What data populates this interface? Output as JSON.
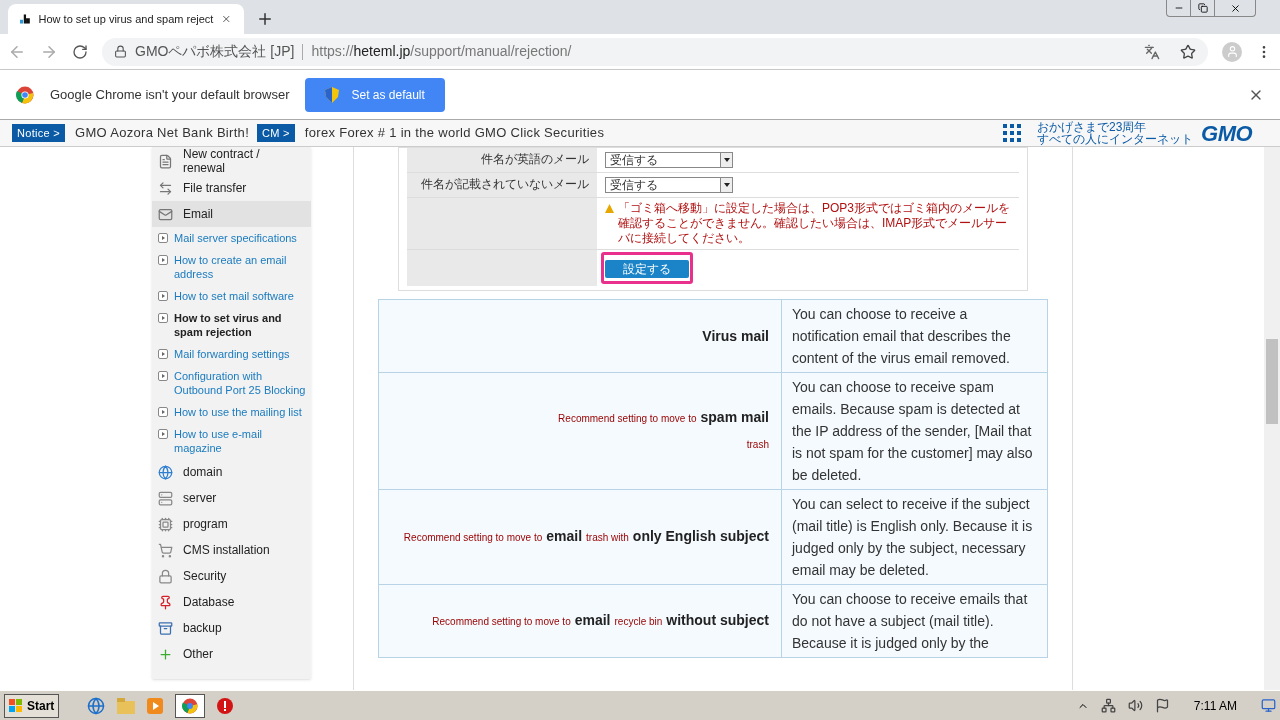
{
  "browser": {
    "tab": {
      "title": "How to set up virus and spam reject"
    },
    "address": {
      "org": "GMOペパボ株式会社 [JP]",
      "scheme": "https://",
      "host": "heteml.jp",
      "path": "/support/manual/rejection/"
    }
  },
  "infobar": {
    "message": "Google Chrome isn't your default browser",
    "button": "Set as default"
  },
  "ticker": {
    "items": [
      {
        "badge": "Notice >",
        "text": "GMO Aozora Net Bank Birth!"
      },
      {
        "badge": "CM >",
        "text": "forex Forex # 1 in the world GMO Click Securities"
      }
    ],
    "logo": {
      "tagline_1": "おかげさまで23周年",
      "tagline_2": "すべての人にインターネット",
      "mark": "GMO"
    }
  },
  "sidebar": {
    "items": [
      {
        "kind": "category",
        "label": "New contract / renewal",
        "selected": false
      },
      {
        "kind": "category",
        "label": "File transfer",
        "selected": false
      },
      {
        "kind": "category",
        "label": "Email",
        "selected": true
      },
      {
        "kind": "link",
        "label": "Mail server specifications",
        "selected": false
      },
      {
        "kind": "link",
        "label": "How to create an email address",
        "selected": false
      },
      {
        "kind": "link",
        "label": "How to set mail software",
        "selected": false
      },
      {
        "kind": "link",
        "label": "How to set virus and spam rejection",
        "selected": true
      },
      {
        "kind": "link",
        "label": "Mail forwarding settings",
        "selected": false
      },
      {
        "kind": "link",
        "label": "Configuration with Outbound Port 25 Blocking",
        "selected": false
      },
      {
        "kind": "link",
        "label": "How to use the mailing list",
        "selected": false
      },
      {
        "kind": "link",
        "label": "How to use e-mail magazine",
        "selected": false
      },
      {
        "kind": "category",
        "label": "domain",
        "selected": false
      },
      {
        "kind": "category",
        "label": "server",
        "selected": false
      },
      {
        "kind": "category",
        "label": "program",
        "selected": false
      },
      {
        "kind": "category",
        "label": "CMS installation",
        "selected": false
      },
      {
        "kind": "category",
        "label": "Security",
        "selected": false
      },
      {
        "kind": "category",
        "label": "Database",
        "selected": false
      },
      {
        "kind": "category",
        "label": "backup",
        "selected": false
      },
      {
        "kind": "category",
        "label": "Other",
        "selected": false
      }
    ]
  },
  "form": {
    "rows": [
      {
        "label": "件名が英語のメール",
        "value": "受信する"
      },
      {
        "label": "件名が記載されていないメール",
        "value": "受信する"
      }
    ],
    "warning": "「ゴミ箱へ移動」に設定した場合は、POP3形式ではゴミ箱内のメールを確認することができません。確認したい場合は、IMAP形式でメールサーバに接続してください。",
    "submit": "設定する"
  },
  "table": {
    "rows": [
      {
        "label_lines": [
          [
            {
              "kind": "term",
              "text": "Virus mail"
            }
          ]
        ],
        "description": "You can choose to receive a notification email that describes the content of the virus email removed."
      },
      {
        "label_lines": [
          [
            {
              "kind": "note",
              "text": "Recommend setting to move to"
            },
            {
              "kind": "term",
              "text": "spam mail"
            }
          ],
          [
            {
              "kind": "note",
              "text": "trash"
            }
          ]
        ],
        "description": "You can choose to receive spam emails. Because spam is detected at the IP address of the sender, [Mail that is not spam for the customer] may also be deleted."
      },
      {
        "label_lines": [
          [
            {
              "kind": "note",
              "text": "Recommend setting to move to"
            },
            {
              "kind": "term",
              "text": "email"
            },
            {
              "kind": "note",
              "text": "trash with"
            },
            {
              "kind": "term",
              "text": "only English subject"
            }
          ]
        ],
        "description": "You can select to receive if the subject (mail title) is English only. Because it is judged only by the subject, necessary email may be deleted."
      },
      {
        "label_lines": [
          [
            {
              "kind": "note",
              "text": "Recommend setting to move to"
            },
            {
              "kind": "term",
              "text": "email"
            },
            {
              "kind": "note",
              "text": "recycle bin"
            },
            {
              "kind": "term",
              "text": "without subject"
            }
          ]
        ],
        "description": "You can choose to receive emails that do not have a subject (mail title). Because it is judged only by the"
      }
    ]
  },
  "taskbar": {
    "start": "Start",
    "clock": "7:11 AM"
  }
}
